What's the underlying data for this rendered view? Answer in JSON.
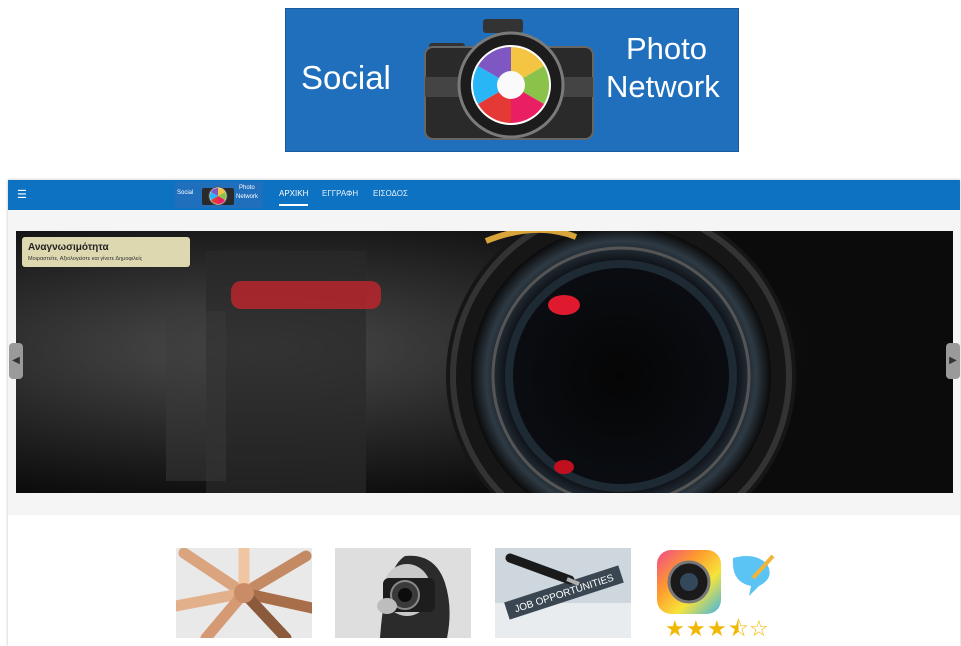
{
  "logo": {
    "word_social": "Social",
    "word_photo": "Photo",
    "word_network": "Network",
    "colors": {
      "background": "#1f6fbd",
      "text": "#ffffff"
    }
  },
  "navbar": {
    "color": "#0d72c2",
    "menu_icon": "hamburger-icon",
    "logo_social": "Social",
    "logo_photo": "Photo",
    "logo_network": "Network",
    "links": [
      {
        "label": "ΑΡΧΙΚΗ",
        "active": true
      },
      {
        "label": "ΕΓΓΡΑΦΗ",
        "active": false
      },
      {
        "label": "ΕΙΣΟΔΟΣ",
        "active": false
      }
    ]
  },
  "carousel": {
    "caption_title": "Αναγνωσιμότητα",
    "caption_text": "Μοιραστείτε, Αξιολογείστε και γίνετε Δημοφιλείς",
    "prev_icon": "chevron-left-icon",
    "next_icon": "chevron-right-icon",
    "slide_count": 3,
    "active_slide": 3
  },
  "thumbnails": [
    {
      "name": "community-hands-image"
    },
    {
      "name": "photographer-image"
    },
    {
      "name": "job-opportunities-image",
      "text": "JOB OPPORTUNITIES"
    },
    {
      "name": "rating-app-image",
      "rating": 3.5,
      "max_rating": 5
    }
  ]
}
